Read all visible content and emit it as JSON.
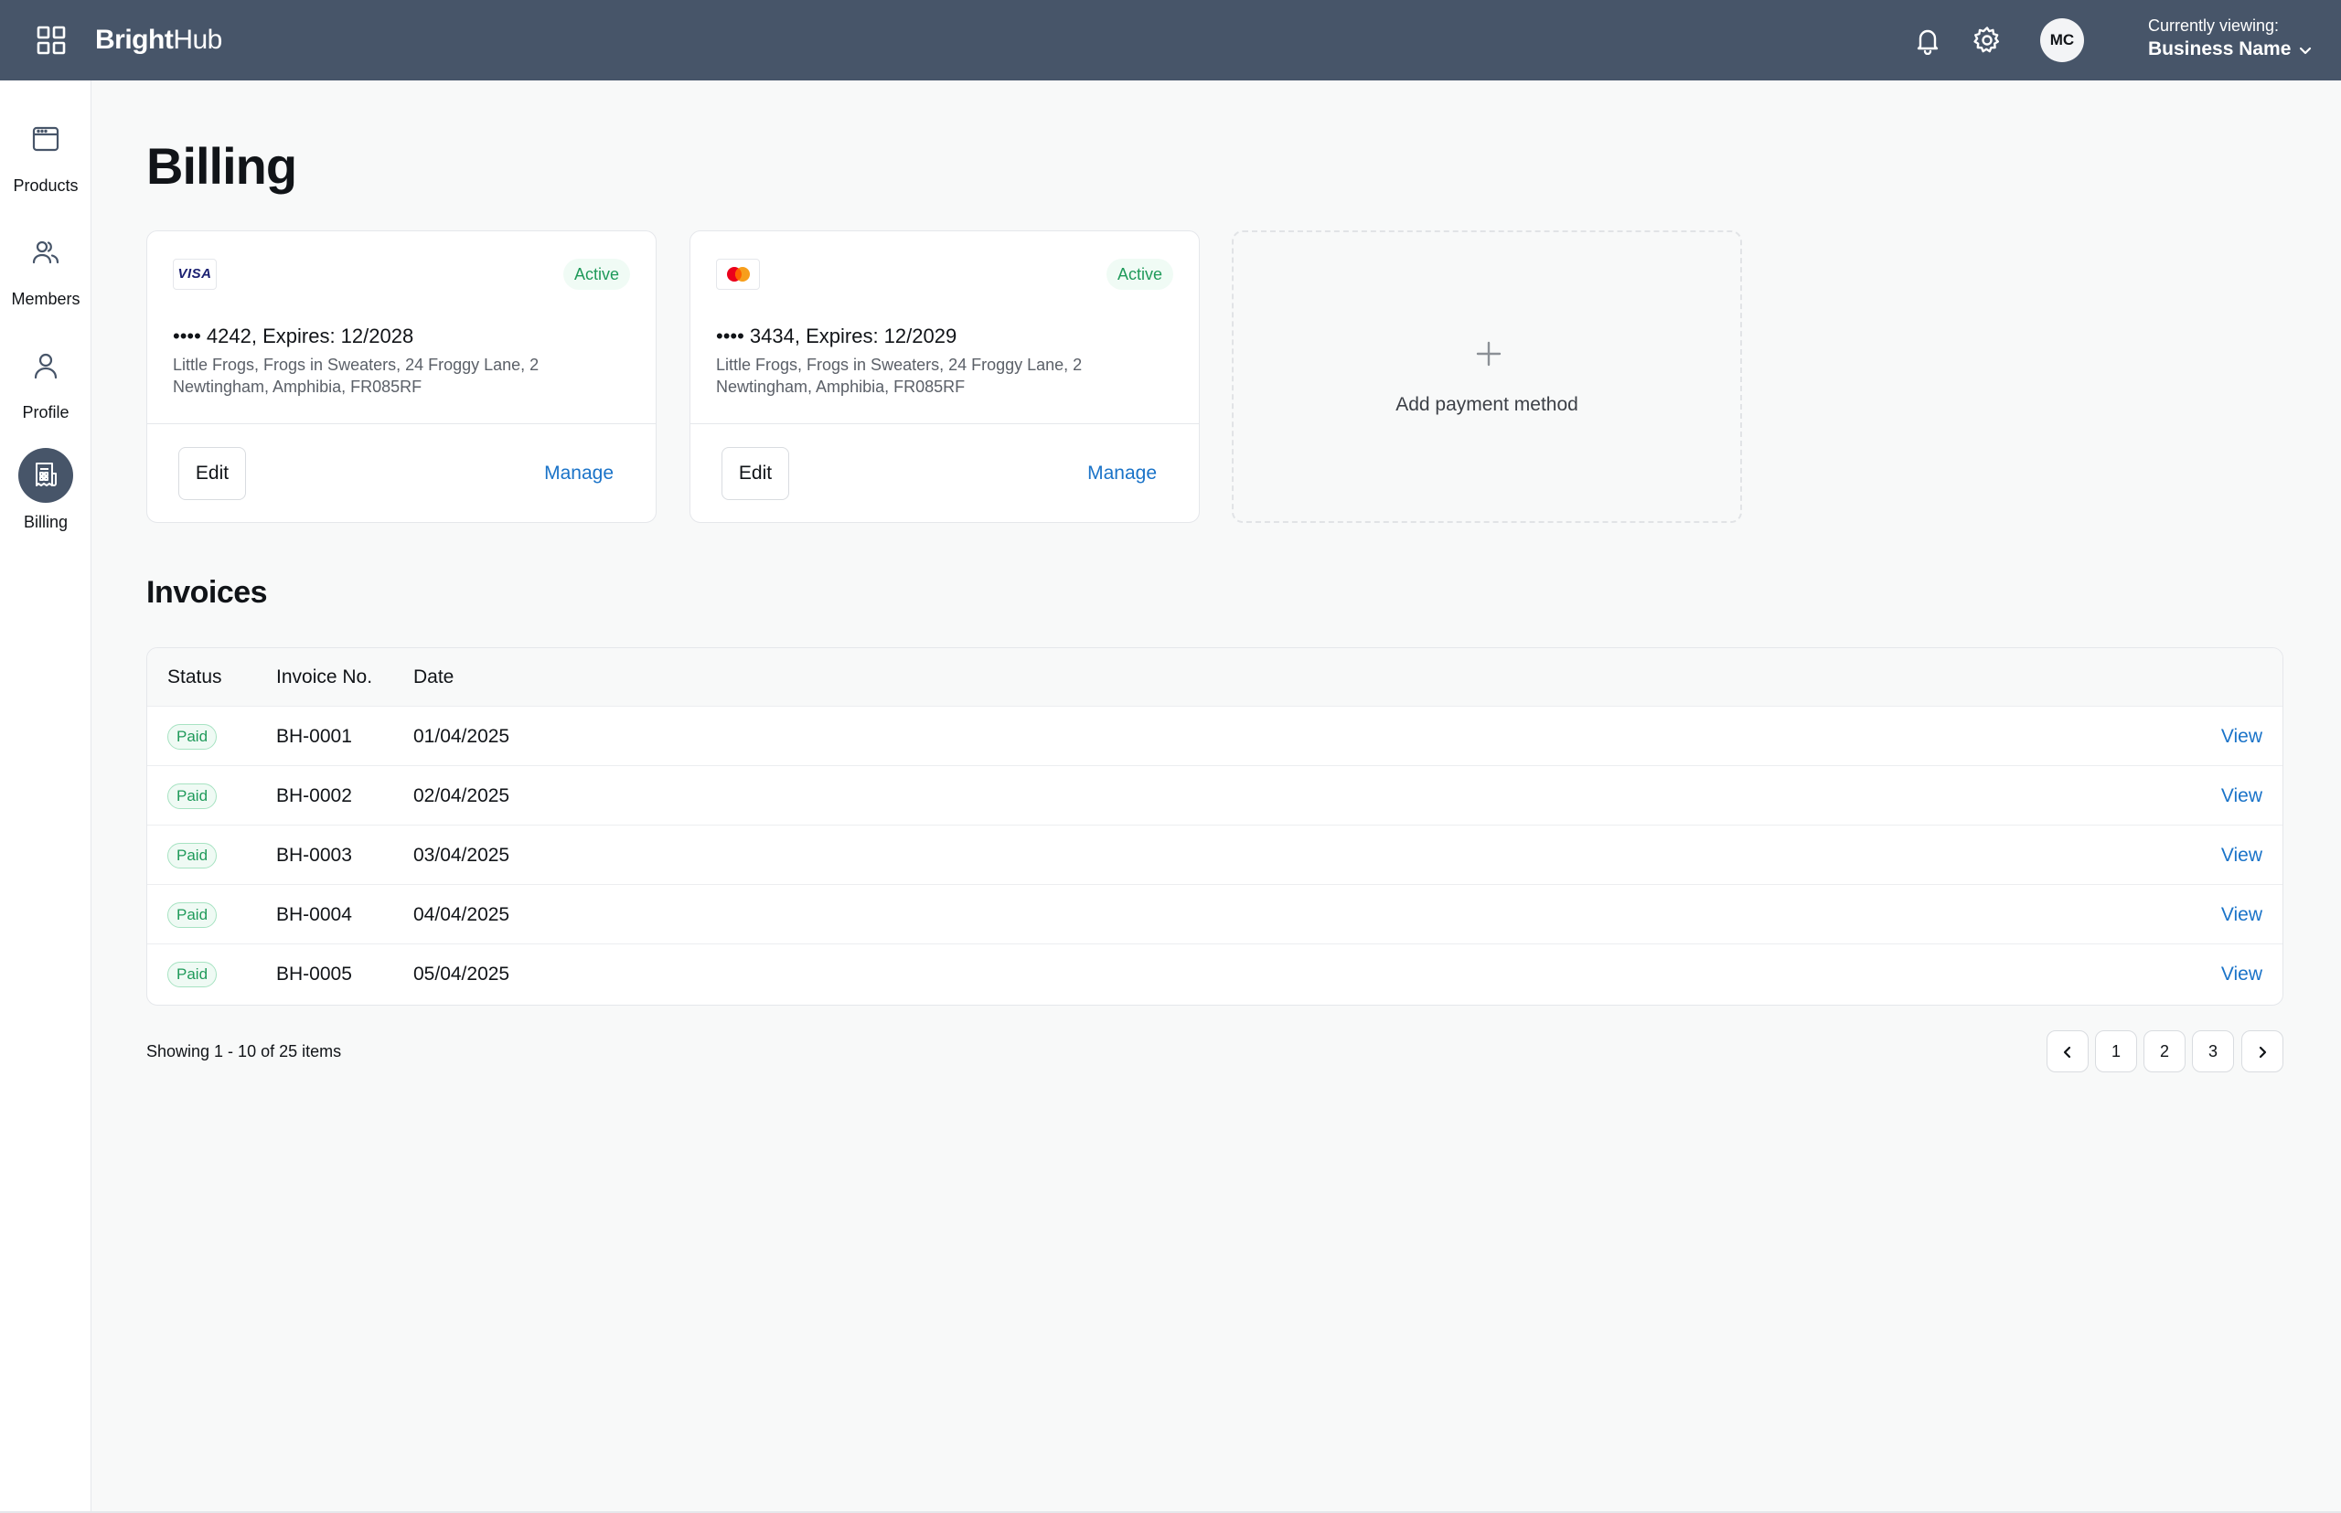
{
  "app": {
    "brand_bold": "Bright",
    "brand_regular": "Hub"
  },
  "header": {
    "avatar_initials": "MC",
    "viewing_label": "Currently viewing:",
    "business_name": "Business Name"
  },
  "sidebar": {
    "items": [
      {
        "label": "Products",
        "icon": "browser-window-icon",
        "active": false
      },
      {
        "label": "Members",
        "icon": "users-icon",
        "active": false
      },
      {
        "label": "Profile",
        "icon": "user-icon",
        "active": false
      },
      {
        "label": "Billing",
        "icon": "receipt-icon",
        "active": true
      }
    ]
  },
  "page": {
    "title": "Billing"
  },
  "payment_methods": [
    {
      "brand": "visa",
      "brand_text": "VISA",
      "status": "Active",
      "number": "•••• 4242, Expires: 12/2028",
      "address_line1": "Little Frogs, Frogs in Sweaters, 24 Froggy Lane, 2",
      "address_line2": "Newtingham, Amphibia, FR085RF",
      "edit_label": "Edit",
      "manage_label": "Manage"
    },
    {
      "brand": "mastercard",
      "status": "Active",
      "number": "•••• 3434, Expires: 12/2029",
      "address_line1": "Little Frogs, Frogs in Sweaters, 24 Froggy Lane, 2",
      "address_line2": "Newtingham, Amphibia, FR085RF",
      "edit_label": "Edit",
      "manage_label": "Manage"
    }
  ],
  "add_payment": {
    "label": "Add payment method"
  },
  "invoices": {
    "title": "Invoices",
    "columns": [
      "Status",
      "Invoice No.",
      "Date"
    ],
    "rows": [
      {
        "status": "Paid",
        "number": "BH-0001",
        "date": "01/04/2025",
        "action": "View"
      },
      {
        "status": "Paid",
        "number": "BH-0002",
        "date": "02/04/2025",
        "action": "View"
      },
      {
        "status": "Paid",
        "number": "BH-0003",
        "date": "03/04/2025",
        "action": "View"
      },
      {
        "status": "Paid",
        "number": "BH-0004",
        "date": "04/04/2025",
        "action": "View"
      },
      {
        "status": "Paid",
        "number": "BH-0005",
        "date": "05/04/2025",
        "action": "View"
      }
    ]
  },
  "pagination": {
    "summary": "Showing 1 - 10 of 25 items",
    "pages": [
      "1",
      "2",
      "3"
    ]
  },
  "colors": {
    "topbar": "#475569",
    "link": "#1a73c8",
    "success": "#1f9a5a",
    "mastercard_red": "#eb001b",
    "mastercard_orange": "#f79e1b"
  }
}
